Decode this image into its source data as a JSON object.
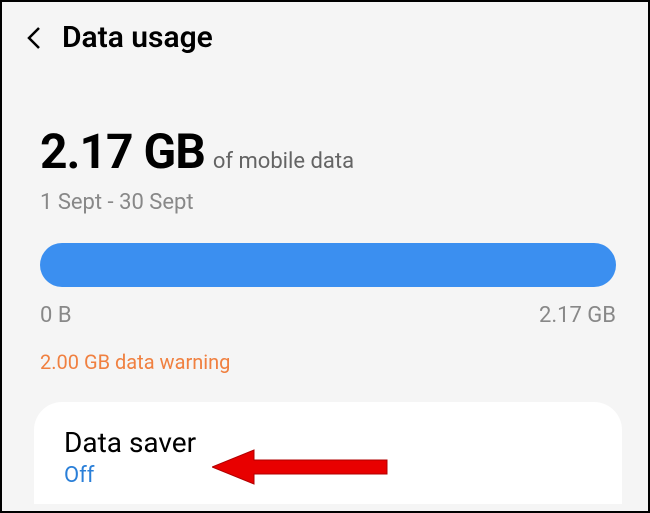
{
  "header": {
    "title": "Data usage"
  },
  "usage": {
    "amount": "2.17 GB",
    "suffix": "of mobile data",
    "date_range": "1 Sept - 30 Sept"
  },
  "bar": {
    "min_label": "0 B",
    "max_label": "2.17 GB"
  },
  "warning": "2.00 GB data warning",
  "data_saver": {
    "title": "Data saver",
    "status": "Off"
  }
}
